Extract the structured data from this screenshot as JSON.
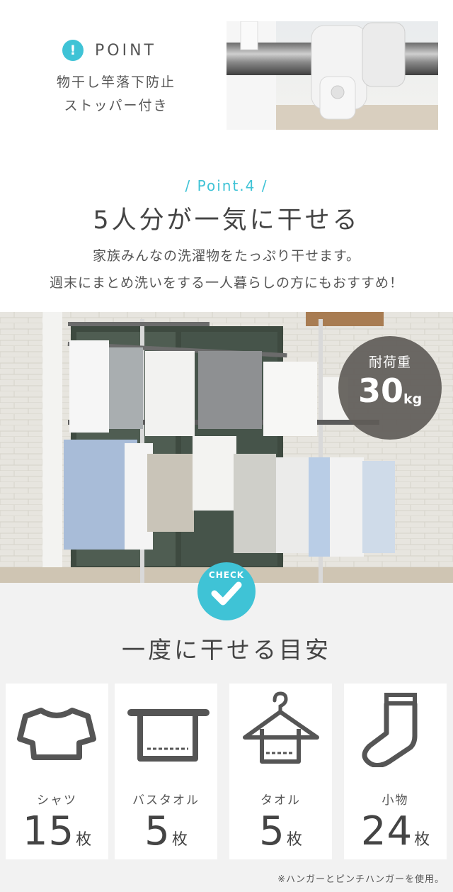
{
  "point": {
    "badge": "!",
    "heading": "POINT",
    "desc_line1": "物干し竿落下防止",
    "desc_line2": "ストッパー付き"
  },
  "point4": {
    "label": "/ Point.4 /",
    "title": "5人分が一気に干せる",
    "desc_line1": "家族みんなの洗濯物をたっぷり干せます。",
    "desc_line2": "週末にまとめ洗いをする一人暮らしの方にもおすすめ！"
  },
  "load": {
    "label": "耐荷重",
    "value": "30",
    "unit": "kg"
  },
  "check": {
    "label": "CHECK"
  },
  "guide": {
    "title": "一度に干せる目安",
    "items": [
      {
        "label": "シャツ",
        "count": "15",
        "unit": "枚",
        "icon": "shirt-icon"
      },
      {
        "label": "バスタオル",
        "count": "5",
        "unit": "枚",
        "icon": "bath-towel-icon"
      },
      {
        "label": "タオル",
        "count": "5",
        "unit": "枚",
        "icon": "towel-hanger-icon"
      },
      {
        "label": "小物",
        "count": "24",
        "unit": "枚",
        "icon": "sock-icon"
      }
    ],
    "note": "※ハンガーとピンチハンガーを使用。"
  },
  "colors": {
    "accent": "#3fc3d6",
    "badge_dark": "#5f5c58",
    "section_gray": "#f2f2f2",
    "icon_stroke": "#555555"
  }
}
